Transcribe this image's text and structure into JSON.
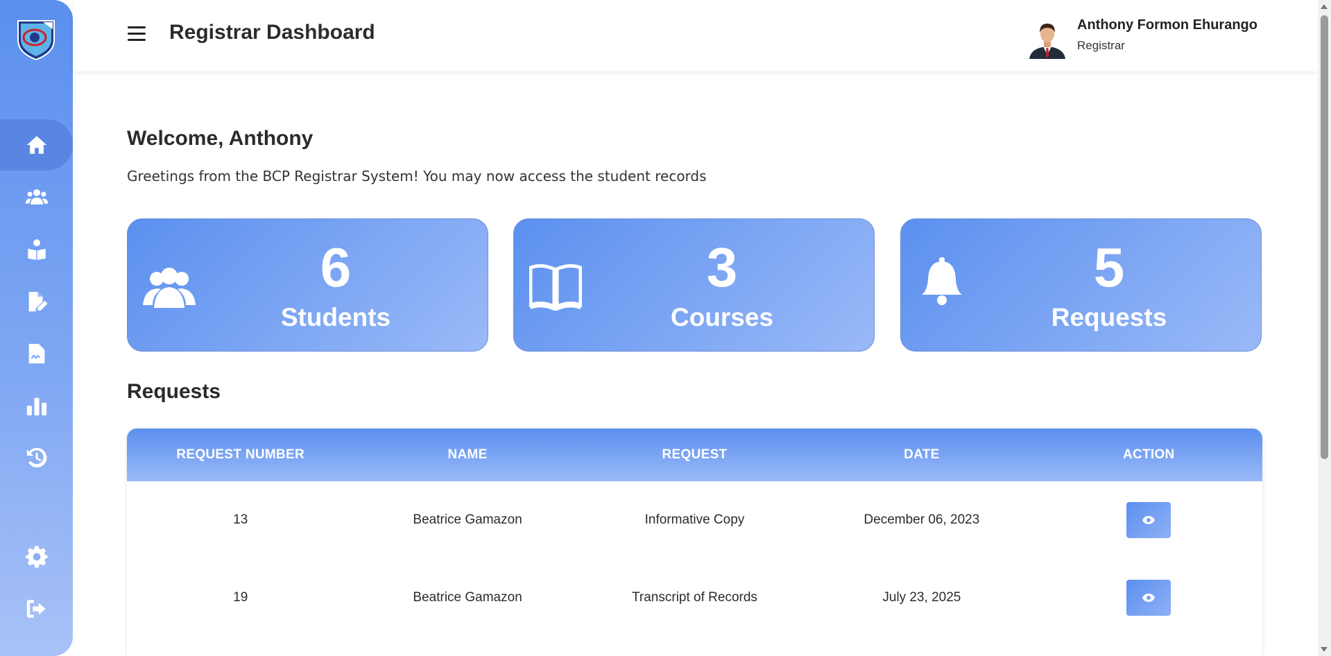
{
  "header": {
    "title": "Registrar Dashboard",
    "user_name": "Anthony Formon Ehurango",
    "user_role": "Registrar"
  },
  "sidebar": {
    "items": [
      {
        "icon": "home-icon",
        "active": true
      },
      {
        "icon": "users-icon",
        "active": false
      },
      {
        "icon": "student-reading-icon",
        "active": false
      },
      {
        "icon": "file-edit-icon",
        "active": false
      },
      {
        "icon": "file-signature-icon",
        "active": false
      },
      {
        "icon": "bar-chart-icon",
        "active": false
      },
      {
        "icon": "history-icon",
        "active": false
      },
      {
        "icon": "gear-icon",
        "active": false
      },
      {
        "icon": "logout-icon",
        "active": false
      }
    ]
  },
  "main": {
    "welcome": "Welcome, Anthony",
    "greeting": "Greetings from the BCP Registrar System! You may now access the student records",
    "cards": [
      {
        "icon": "users-icon",
        "value": "6",
        "label": "Students"
      },
      {
        "icon": "book-icon",
        "value": "3",
        "label": "Courses"
      },
      {
        "icon": "bell-icon",
        "value": "5",
        "label": "Requests"
      }
    ],
    "requests_title": "Requests",
    "table": {
      "headers": [
        "REQUEST NUMBER",
        "NAME",
        "REQUEST",
        "DATE",
        "ACTION"
      ],
      "rows": [
        {
          "number": "13",
          "name": "Beatrice Gamazon",
          "request": "Informative Copy",
          "date": "December 06, 2023",
          "action": "eye-icon"
        },
        {
          "number": "19",
          "name": "Beatrice Gamazon",
          "request": "Transcript of Records",
          "date": "July 23, 2025",
          "action": "eye-icon"
        }
      ]
    }
  },
  "colors": {
    "accent": "#5b90ef",
    "accent_light": "#9ab9f7",
    "text": "#2b2b2b"
  }
}
